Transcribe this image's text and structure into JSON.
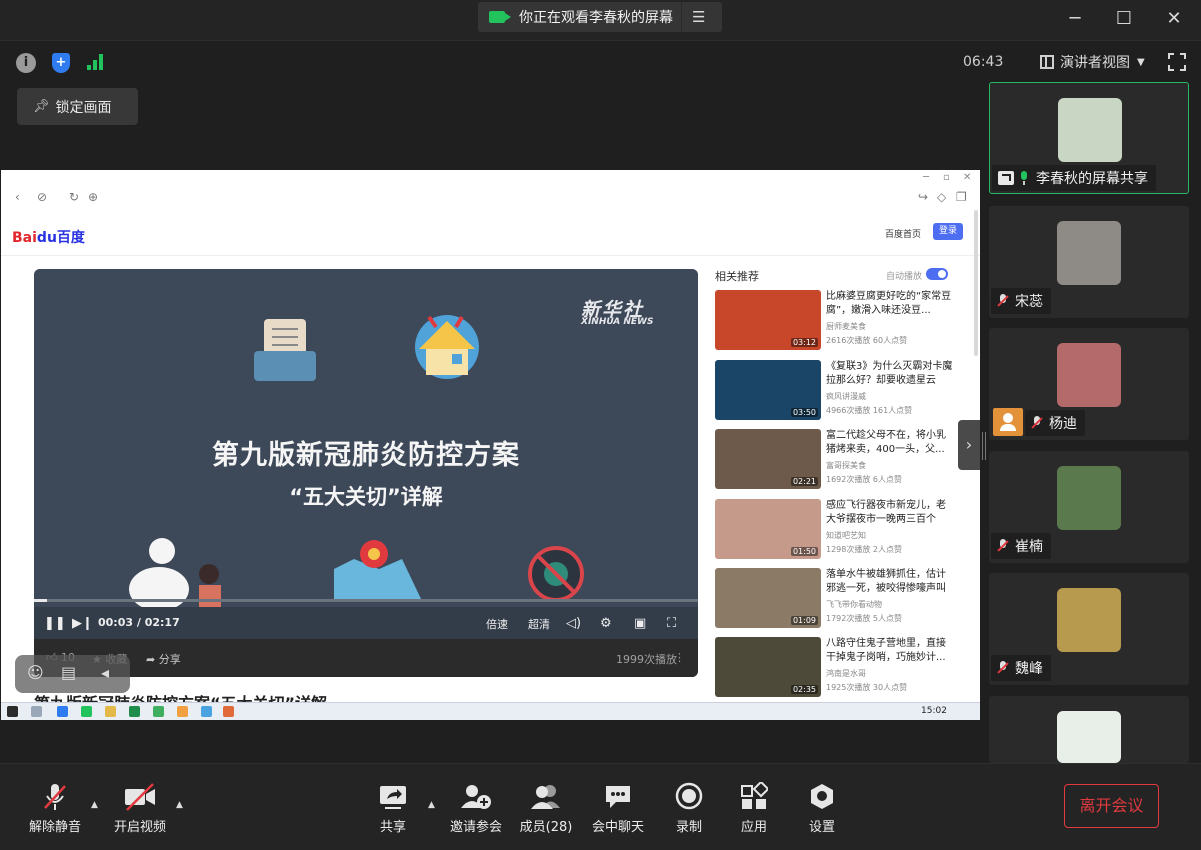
{
  "titlebar": {
    "title": "你正在观看李春秋的屏幕",
    "minimize": "─",
    "maximize": "☐",
    "close": "✕"
  },
  "infobar": {
    "info_glyph": "i",
    "shield_glyph": "+",
    "clock": "06:43",
    "presenter_view": "演讲者视图"
  },
  "lock_button": "锁定画面",
  "shared_screen": {
    "baidu": {
      "logo_a": "Bai",
      "logo_b": "du百度",
      "home": "百度首页",
      "login": "登录"
    },
    "video": {
      "watermark_cn": "新华社",
      "watermark_en": "XINHUA NEWS",
      "title": "第九版新冠肺炎防控方案",
      "subtitle": "“五大关切”详解",
      "time_current": "00:03",
      "time_total": "02:17",
      "time_sep": " / ",
      "progress": 0.02,
      "speed": "倍速",
      "quality": "超清",
      "likes": "10",
      "favorite": "收藏",
      "share": "分享",
      "views": "1999次播放"
    },
    "below_title": "第九版新冠肺炎防控方案“五大关切”详解",
    "recommend": {
      "heading": "相关推荐",
      "autoplay": "自动播放",
      "items": [
        {
          "title": "比麻婆豆腐更好吃的“家常豆腐”，嫩滑入味还没豆...",
          "source": "厨师麦美食",
          "stats": "2616次播放 60人点赞",
          "duration": "03:12",
          "color": "#c8462a"
        },
        {
          "title": "《复联3》为什么灭霸对卡魔拉那么好？却要收遗星云",
          "source": "疯风讲漫威",
          "stats": "4966次播放 161人点赞",
          "duration": "03:50",
          "color": "#1b4566"
        },
        {
          "title": "富二代趁父母不在，将小乳猪烤来卖，400一头，父...",
          "source": "富哥探美食",
          "stats": "1692次播放 6人点赞",
          "duration": "02:21",
          "color": "#6e5a4a"
        },
        {
          "title": "感应飞行器夜市新宠儿，老大爷摆夜市一晚两三百个",
          "source": "知道吧艺知",
          "stats": "1298次播放 2人点赞",
          "duration": "01:50",
          "color": "#c59a8a"
        },
        {
          "title": "落单水牛被雄狮抓住，估计邪逃一死，被咬得惨嚎声叫",
          "source": "飞飞带你看动物",
          "stats": "1792次播放 5人点赞",
          "duration": "01:09",
          "color": "#8a7a66"
        },
        {
          "title": "八路守住鬼子营地里，直接干掉鬼子岗哨，巧施妙计...",
          "source": "鸿南是水哥",
          "stats": "1925次播放 30人点赞",
          "duration": "02:35",
          "color": "#4e4a3a"
        }
      ]
    },
    "taskbar_time": "15:02"
  },
  "participants": [
    {
      "name": "李春秋的屏幕共享",
      "mic": "on",
      "sharing": true,
      "avatar_color": "#c9d6c4"
    },
    {
      "name": "宋蕊",
      "mic": "muted",
      "sharing": false,
      "avatar_color": "#8e8a86"
    },
    {
      "name": "杨迪",
      "mic": "muted",
      "sharing": false,
      "host": true,
      "avatar_color": "#b46a6a"
    },
    {
      "name": "崔楠",
      "mic": "muted",
      "sharing": false,
      "avatar_color": "#5a7a4e"
    },
    {
      "name": "魏峰",
      "mic": "muted",
      "sharing": false,
      "avatar_color": "#b89a4e"
    },
    {
      "name": "",
      "mic": "",
      "sharing": false,
      "avatar_color": "#e8efe8"
    }
  ],
  "toolbar": {
    "unmute": "解除静音",
    "start_video": "开启视频",
    "share": "共享",
    "invite": "邀请参会",
    "members": "成员(28)",
    "chat": "会中聊天",
    "record": "录制",
    "apps": "应用",
    "settings": "设置",
    "leave": "离开会议"
  },
  "colors": {
    "accent_green": "#22c35c",
    "leave_red": "#e0393e",
    "baidu_blue": "#4e6ef2"
  }
}
